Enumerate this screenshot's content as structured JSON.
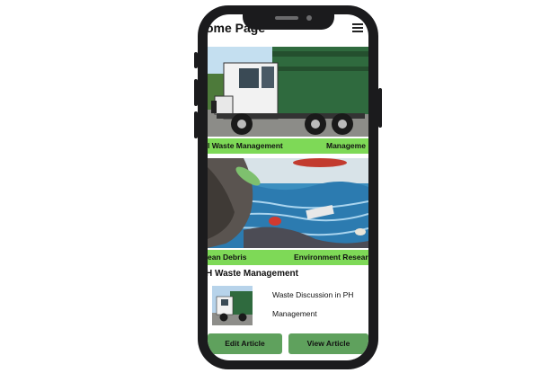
{
  "header": {
    "title": "ome Page"
  },
  "carousel": [
    {
      "caption_left": "l Waste Management",
      "caption_right": "Manageme"
    },
    {
      "caption_left": "ean Debris",
      "caption_right": "Environment Research"
    }
  ],
  "article": {
    "section_title": "H Waste Management",
    "text": "Waste Discussion in PH Management"
  },
  "actions": {
    "edit_label": "Edit Article",
    "view_label": "View Article"
  },
  "colors": {
    "accent_green": "#7ed957",
    "button_green": "#5fa15d",
    "device": "#1b1b1d"
  },
  "icons": {
    "menu": "hamburger-menu-icon"
  }
}
